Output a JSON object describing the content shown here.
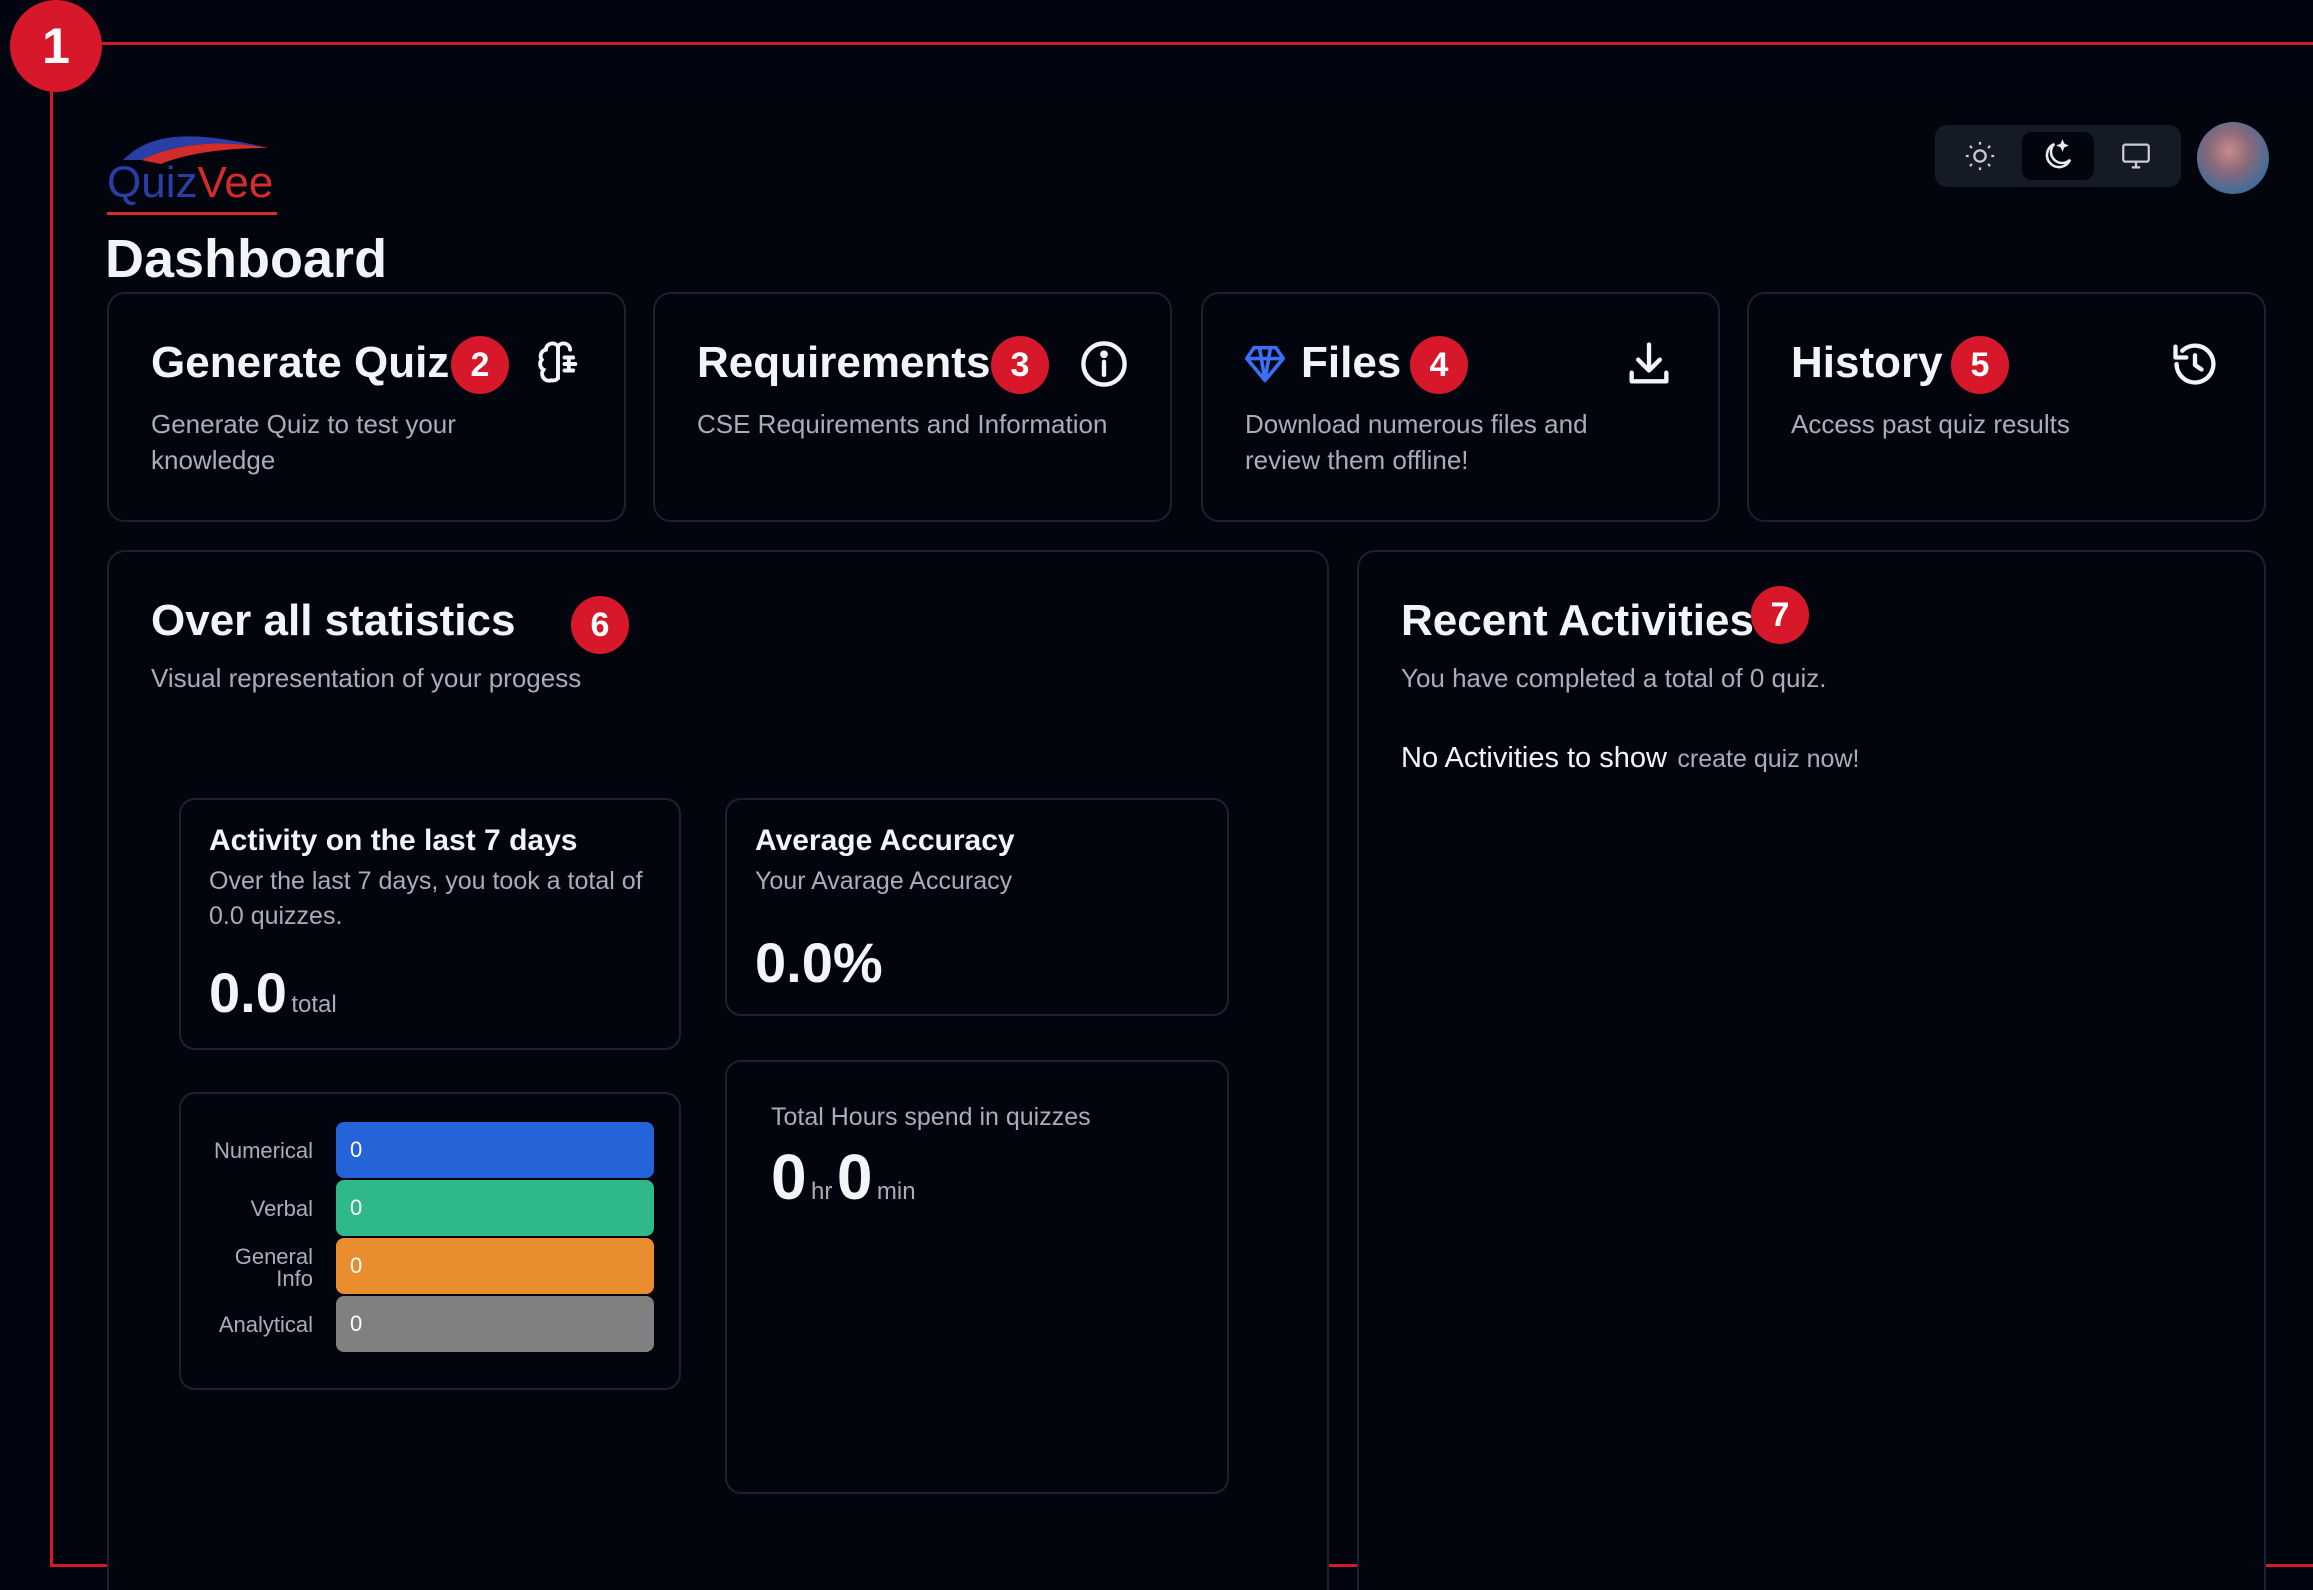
{
  "annotations": [
    "1",
    "2",
    "3",
    "4",
    "5",
    "6",
    "7"
  ],
  "app": {
    "logo": {
      "part1": "Quiz",
      "part2": "Vee"
    },
    "theme_options": [
      "light-icon",
      "dark-icon",
      "system-icon"
    ],
    "page_title": "Dashboard"
  },
  "cards": {
    "generate": {
      "title": "Generate Quiz",
      "desc": "Generate Quiz to test your knowledge",
      "icon": "brain-icon"
    },
    "requirements": {
      "title": "Requirements",
      "desc": "CSE Requirements and Information",
      "icon": "info-icon"
    },
    "files": {
      "title": "Files",
      "desc": "Download numerous files and review them offline!",
      "icon": "download-icon"
    },
    "history": {
      "title": "History",
      "desc": "Access past quiz results",
      "icon": "history-icon"
    }
  },
  "stats": {
    "title": "Over all statistics",
    "subtitle": "Visual representation of your progess",
    "activity": {
      "title": "Activity on the last 7 days",
      "desc": "Over the last 7 days, you took a total of 0.0 quizzes.",
      "value": "0.0",
      "unit": "total"
    },
    "accuracy": {
      "title": "Average Accuracy",
      "desc": "Your Avarage Accuracy",
      "value": "0.0%"
    },
    "hours": {
      "label": "Total Hours spend in quizzes",
      "hr_value": "0",
      "hr_unit": "hr",
      "min_value": "0",
      "min_unit": "min"
    },
    "categories": [
      {
        "label": "Numerical",
        "value": "0",
        "color": "#2563d9"
      },
      {
        "label": "Verbal",
        "value": "0",
        "color": "#2fb98a"
      },
      {
        "label": "General Info",
        "value": "0",
        "color": "#e98d2f"
      },
      {
        "label": "Analytical",
        "value": "0",
        "color": "#808080"
      }
    ]
  },
  "recent": {
    "title": "Recent Activities",
    "subtitle": "You have completed a total of 0 quiz.",
    "empty": "No Activities to show",
    "link": "create quiz now!"
  },
  "colors": {
    "accent_red": "#d7172a",
    "background": "#03050e",
    "border": "#1c2132"
  }
}
